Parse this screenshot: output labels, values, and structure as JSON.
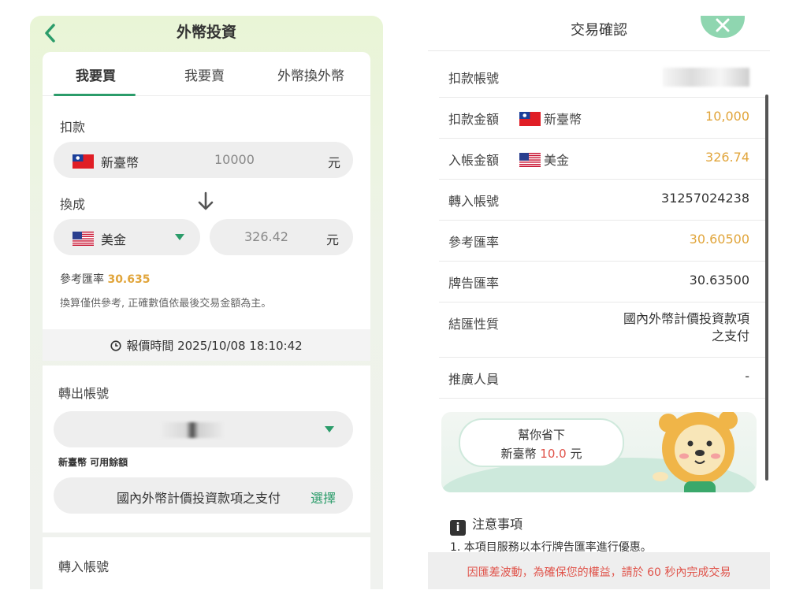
{
  "left": {
    "title": "外幣投資",
    "tabs": [
      {
        "label": "我要買",
        "active": true
      },
      {
        "label": "我要賣",
        "active": false
      },
      {
        "label": "外幣換外幣",
        "active": false
      }
    ],
    "debit_label": "扣款",
    "debit_currency": "新臺幣",
    "debit_amount": "10000",
    "debit_unit": "元",
    "convert_label": "換成",
    "target_currency": "美金",
    "target_amount": "326.42",
    "target_unit": "元",
    "rate_label": "參考匯率",
    "rate_value": "30.635",
    "note": "換算僅供參考, 正確數值依最後交易金額為主。",
    "quote_time": "報價時間 2025/10/08 18:10:42",
    "out_account_label": "轉出帳號",
    "balance_label": "新臺幣 可用餘額",
    "purpose_value": "國內外幣計價投資款項之支付",
    "purpose_select": "選擇",
    "in_account_label": "轉入帳號",
    "accent_color": "#2b9c6a",
    "highlight_color": "#e1a53b"
  },
  "right": {
    "title": "交易確認",
    "rows": [
      {
        "key": "扣款帳號",
        "value": ""
      },
      {
        "key": "扣款金額",
        "currency": "新臺幣",
        "value": "10,000"
      },
      {
        "key": "入帳金額",
        "currency": "美金",
        "value": "326.74"
      },
      {
        "key": "轉入帳號",
        "value": "31257024238"
      },
      {
        "key": "參考匯率",
        "value": "30.60500"
      },
      {
        "key": "牌告匯率",
        "value": "30.63500"
      },
      {
        "key": "結匯性質",
        "value_line1": "國內外幣計價投資款項",
        "value_line2": "之支付"
      },
      {
        "key": "推廣人員",
        "value": "-"
      }
    ],
    "savings": {
      "line1": "幫你省下",
      "currency": "新臺幣",
      "amount": "10.0",
      "unit": "元"
    },
    "notice_title": "注意事項",
    "notice_line1": "1. 本項目服務以本行牌告匯率進行優惠。",
    "warning": "因匯差波動，為確保您的權益，請於 60 秒內完成交易",
    "warning_color": "#e0534a"
  }
}
